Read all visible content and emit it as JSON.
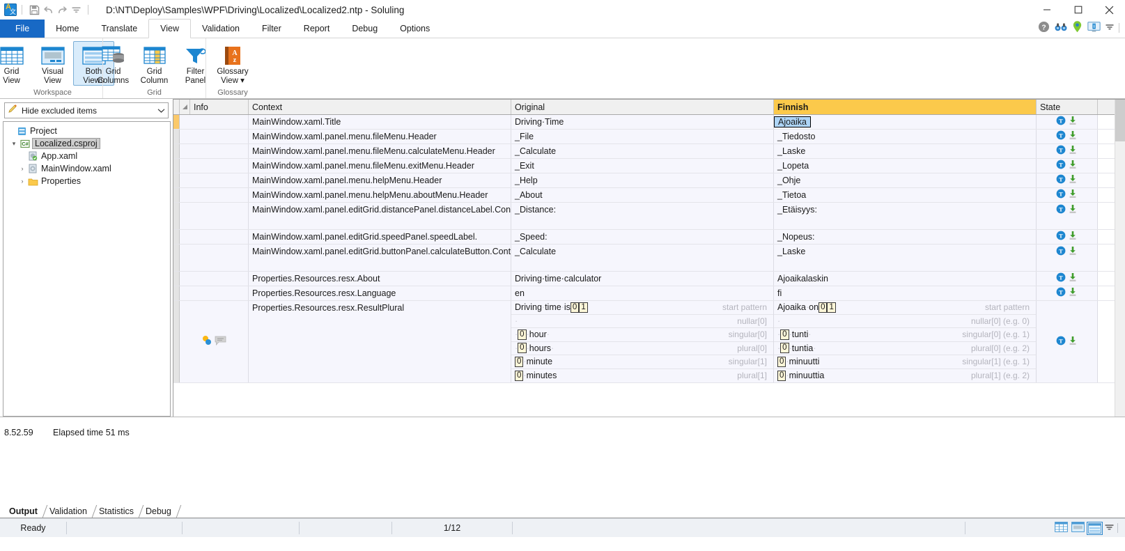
{
  "window": {
    "title": "D:\\NT\\Deploy\\Samples\\WPF\\Driving\\Localized\\Localized2.ntp  -  Soluling",
    "app_icon": "soluling-app-icon",
    "quick_access": [
      {
        "name": "save-icon",
        "label": "Save"
      },
      {
        "name": "undo-icon",
        "label": "Undo"
      },
      {
        "name": "redo-icon",
        "label": "Redo"
      },
      {
        "name": "customize-qat-icon",
        "label": "Customize Quick Access Toolbar"
      }
    ],
    "controls": [
      {
        "name": "minimize-button",
        "glyph": "–"
      },
      {
        "name": "maximize-button",
        "glyph": "☐"
      },
      {
        "name": "close-button",
        "glyph": "✕"
      }
    ]
  },
  "ribbon": {
    "tabs": [
      {
        "label": "File",
        "id": "file",
        "active": false
      },
      {
        "label": "Home",
        "id": "home",
        "active": false
      },
      {
        "label": "Translate",
        "id": "translate",
        "active": false
      },
      {
        "label": "View",
        "id": "view",
        "active": true
      },
      {
        "label": "Validation",
        "id": "validation",
        "active": false
      },
      {
        "label": "Filter",
        "id": "filter",
        "active": false
      },
      {
        "label": "Report",
        "id": "report",
        "active": false
      },
      {
        "label": "Debug",
        "id": "debug",
        "active": false
      },
      {
        "label": "Options",
        "id": "options",
        "active": false
      }
    ],
    "right_icons": [
      {
        "name": "help-icon"
      },
      {
        "name": "binoculars-icon"
      },
      {
        "name": "location-pin-icon"
      },
      {
        "name": "monitor-info-icon"
      },
      {
        "name": "ribbon-options-dropdown-icon"
      }
    ],
    "groups": [
      {
        "label": "Workspace",
        "items": [
          {
            "label1": "Grid",
            "label2": "View",
            "icon": "grid-view-icon",
            "selected": false
          },
          {
            "label1": "Visual",
            "label2": "View",
            "icon": "visual-view-icon",
            "selected": false
          },
          {
            "label1": "Both",
            "label2": "Views",
            "icon": "both-views-icon",
            "selected": true
          }
        ]
      },
      {
        "label": "Grid",
        "items": [
          {
            "label1": "Grid",
            "label2": "Columns",
            "icon": "grid-columns-icon",
            "selected": false
          },
          {
            "label1": "Grid",
            "label2": "Column",
            "icon": "grid-column-icon",
            "selected": false
          },
          {
            "label1": "Filter",
            "label2": "Panel",
            "icon": "filter-panel-icon",
            "selected": false
          }
        ]
      },
      {
        "label": "Glossary",
        "items": [
          {
            "label1": "Glossary",
            "label2": "View ▾",
            "icon": "glossary-view-icon",
            "selected": false
          }
        ]
      }
    ]
  },
  "left_pane": {
    "filter": {
      "icon": "pencil-icon",
      "value": "Hide excluded items",
      "dropdown_icon": "chevron-down-icon"
    },
    "tree": [
      {
        "label": "Project",
        "icon": "project-icon",
        "indent": 0,
        "expander": "",
        "selected": false
      },
      {
        "label": "Localized.csproj",
        "icon": "csharp-project-icon",
        "indent": 1,
        "expander": "▾",
        "selected": true
      },
      {
        "label": "App.xaml",
        "icon": "xaml-file-ok-icon",
        "indent": 2,
        "expander": "",
        "selected": false
      },
      {
        "label": "MainWindow.xaml",
        "icon": "xaml-file-icon",
        "indent": 2,
        "expander": "›",
        "selected": false
      },
      {
        "label": "Properties",
        "icon": "folder-icon",
        "indent": 2,
        "expander": "›",
        "selected": false
      }
    ]
  },
  "grid": {
    "columns": [
      {
        "label": "Info",
        "key": "info"
      },
      {
        "label": "Context",
        "key": "context"
      },
      {
        "label": "Original",
        "key": "original"
      },
      {
        "label": "Finnish",
        "key": "finnish",
        "highlight": "#fbc94b"
      },
      {
        "label": "State",
        "key": "state"
      }
    ],
    "rows": [
      {
        "marker": "active",
        "context": "MainWindow.xaml.Title",
        "original": "Driving·Time",
        "finnish": "Ajoaika",
        "finnish_edit": true,
        "state": [
          "translated-icon",
          "download-icon"
        ]
      },
      {
        "marker": "normal",
        "context": "MainWindow.xaml.panel.menu.fileMenu.Header",
        "original": "_File",
        "finnish": "_Tiedosto",
        "state": [
          "translated-icon",
          "download-icon"
        ]
      },
      {
        "marker": "normal",
        "context": "MainWindow.xaml.panel.menu.fileMenu.calculateMenu.Header",
        "original": "_Calculate",
        "finnish": "_Laske",
        "state": [
          "translated-icon",
          "download-icon"
        ]
      },
      {
        "marker": "normal",
        "context": "MainWindow.xaml.panel.menu.fileMenu.exitMenu.Header",
        "original": "_Exit",
        "finnish": "_Lopeta",
        "state": [
          "translated-icon",
          "download-icon"
        ]
      },
      {
        "marker": "normal",
        "context": "MainWindow.xaml.panel.menu.helpMenu.Header",
        "original": "_Help",
        "finnish": "_Ohje",
        "state": [
          "translated-icon",
          "download-icon"
        ]
      },
      {
        "marker": "normal",
        "context": "MainWindow.xaml.panel.menu.helpMenu.aboutMenu.Header",
        "original": "_About",
        "finnish": "_Tietoa",
        "state": [
          "translated-icon",
          "download-icon"
        ]
      },
      {
        "marker": "normal",
        "context": "MainWindow.xaml.panel.editGrid.distancePanel.distanceLabel.Content",
        "original": "_Distance:",
        "finnish": "_Etäisyys:",
        "tall": true,
        "state": [
          "translated-icon",
          "download-icon"
        ]
      },
      {
        "marker": "normal",
        "context": "MainWindow.xaml.panel.editGrid.speedPanel.speedLabel.",
        "original": "_Speed:",
        "finnish": "_Nopeus:",
        "state": [
          "translated-icon",
          "download-icon"
        ]
      },
      {
        "marker": "normal",
        "context": "MainWindow.xaml.panel.editGrid.buttonPanel.calculateButton.Content",
        "original": "_Calculate",
        "finnish": "_Laske",
        "tall": true,
        "state": [
          "translated-icon",
          "download-icon"
        ]
      },
      {
        "marker": "normal",
        "context": "Properties.Resources.resx.About",
        "original": "Driving·time·calculator",
        "finnish": "Ajoaikalaskin",
        "state": [
          "translated-icon",
          "download-icon"
        ]
      },
      {
        "marker": "normal",
        "context": "Properties.Resources.resx.Language",
        "original": "en",
        "finnish": "fi",
        "state": [
          "translated-icon",
          "download-icon"
        ]
      }
    ],
    "plural_row": {
      "marker": "normal",
      "context": "Properties.Resources.resx.ResultPlural",
      "info_icons": [
        "plural-dots-icon",
        "comment-icon"
      ],
      "state": [
        "translated-icon",
        "download-icon"
      ],
      "original_lines": [
        {
          "parts": [
            {
              "t": "text",
              "v": "Driving·time·is"
            },
            {
              "t": "ph",
              "v": "0"
            },
            {
              "t": "ph",
              "v": "1"
            }
          ],
          "annotation": "start pattern"
        },
        {
          "parts": [
            {
              "t": "dot",
              "v": "·"
            }
          ],
          "annotation": "nullar[0]"
        },
        {
          "parts": [
            {
              "t": "dot",
              "v": "·"
            },
            {
              "t": "ph",
              "v": "0"
            },
            {
              "t": "dot",
              "v": "·"
            },
            {
              "t": "text",
              "v": "hour"
            },
            {
              "t": "dot",
              "v": "·"
            }
          ],
          "annotation": "singular[0]"
        },
        {
          "parts": [
            {
              "t": "dot",
              "v": "·"
            },
            {
              "t": "ph",
              "v": "0"
            },
            {
              "t": "dot",
              "v": "·"
            },
            {
              "t": "text",
              "v": "hours"
            },
            {
              "t": "dot",
              "v": "·"
            }
          ],
          "annotation": "plural[0]"
        },
        {
          "parts": [
            {
              "t": "ph",
              "v": "0"
            },
            {
              "t": "dot",
              "v": "·"
            },
            {
              "t": "text",
              "v": "minute"
            }
          ],
          "annotation": "singular[1]"
        },
        {
          "parts": [
            {
              "t": "ph",
              "v": "0"
            },
            {
              "t": "dot",
              "v": "·"
            },
            {
              "t": "text",
              "v": "minutes"
            }
          ],
          "annotation": "plural[1]"
        }
      ],
      "finnish_lines": [
        {
          "parts": [
            {
              "t": "text",
              "v": "Ajoaika·on"
            },
            {
              "t": "ph",
              "v": "0"
            },
            {
              "t": "ph",
              "v": "1"
            }
          ],
          "annotation": "start pattern"
        },
        {
          "parts": [
            {
              "t": "dot",
              "v": "·"
            }
          ],
          "annotation": "nullar[0] (e.g. 0)"
        },
        {
          "parts": [
            {
              "t": "dot",
              "v": "·"
            },
            {
              "t": "ph",
              "v": "0"
            },
            {
              "t": "dot",
              "v": "·"
            },
            {
              "t": "text",
              "v": "tunti"
            },
            {
              "t": "dot",
              "v": "·"
            }
          ],
          "annotation": "singular[0] (e.g. 1)"
        },
        {
          "parts": [
            {
              "t": "dot",
              "v": "·"
            },
            {
              "t": "ph",
              "v": "0"
            },
            {
              "t": "dot",
              "v": "·"
            },
            {
              "t": "text",
              "v": "tuntia"
            },
            {
              "t": "dot",
              "v": "·"
            }
          ],
          "annotation": "plural[0] (e.g. 2)"
        },
        {
          "parts": [
            {
              "t": "ph",
              "v": "0"
            },
            {
              "t": "dot",
              "v": "·"
            },
            {
              "t": "text",
              "v": "minuutti"
            }
          ],
          "annotation": "singular[1] (e.g. 1)"
        },
        {
          "parts": [
            {
              "t": "ph",
              "v": "0"
            },
            {
              "t": "dot",
              "v": "·"
            },
            {
              "t": "text",
              "v": "minuuttia"
            }
          ],
          "annotation": "plural[1] (e.g. 2)"
        }
      ]
    }
  },
  "output": {
    "log": [
      {
        "time": "8.52.59",
        "message": "Elapsed time 51 ms"
      }
    ],
    "tabs": [
      {
        "label": "Output",
        "active": true
      },
      {
        "label": "Validation",
        "active": false
      },
      {
        "label": "Statistics",
        "active": false
      },
      {
        "label": "Debug",
        "active": false
      }
    ]
  },
  "status_bar": {
    "ready_text": "Ready",
    "position": "1/12",
    "view_icons": [
      "grid-view-small-icon",
      "visual-view-small-icon",
      "both-views-small-icon",
      "view-dropdown-icon"
    ]
  }
}
